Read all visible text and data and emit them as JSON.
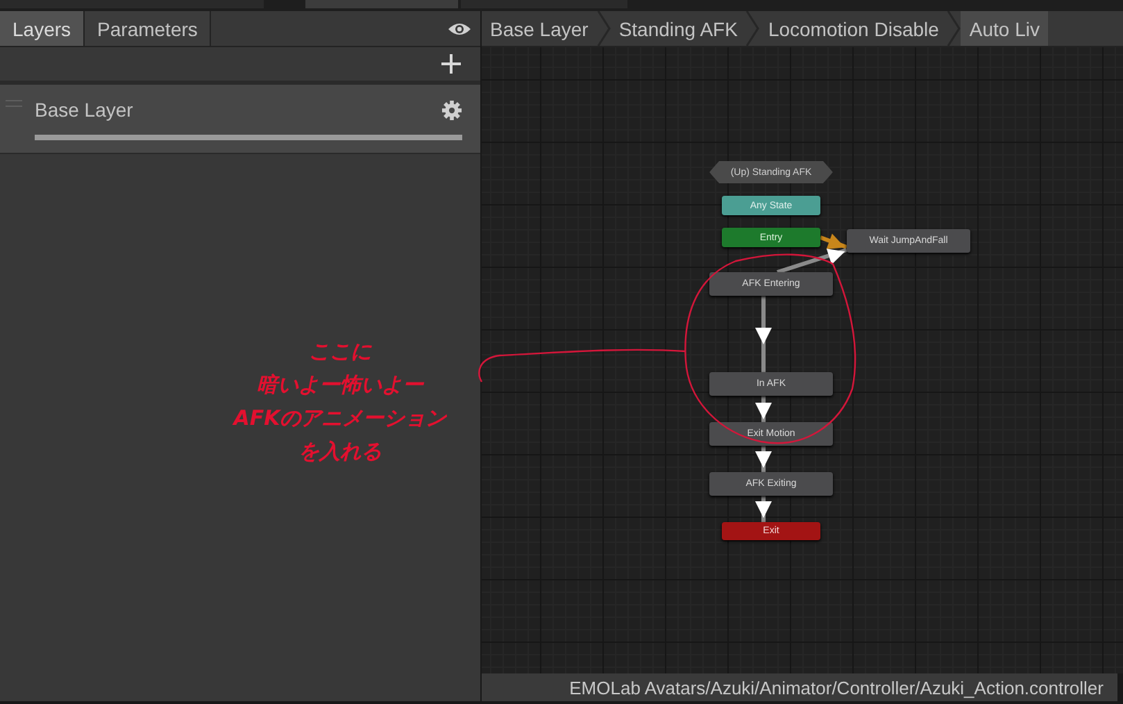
{
  "panel_tabs": [
    {
      "label": "Layers",
      "selected": true
    },
    {
      "label": "Parameters",
      "selected": false
    }
  ],
  "layers": [
    {
      "name": "Base Layer"
    }
  ],
  "annotation": {
    "lines": [
      "ここに",
      "暗いよー怖いよー",
      "AFKのアニメーション",
      "を入れる"
    ]
  },
  "breadcrumbs": [
    {
      "label": "Base Layer",
      "selected": false
    },
    {
      "label": "Standing AFK",
      "selected": false
    },
    {
      "label": "Locomotion Disable",
      "selected": false
    },
    {
      "label": "Auto Liv",
      "selected": true
    }
  ],
  "graph": {
    "nodes": [
      {
        "label": "(Up) Standing AFK",
        "kind": "parent"
      },
      {
        "label": "Any State",
        "kind": "any"
      },
      {
        "label": "Entry",
        "kind": "entry"
      },
      {
        "label": "Wait JumpAndFall",
        "kind": "state"
      },
      {
        "label": "AFK Entering",
        "kind": "state"
      },
      {
        "label": "In AFK",
        "kind": "state"
      },
      {
        "label": "Exit Motion",
        "kind": "state"
      },
      {
        "label": "AFK Exiting",
        "kind": "state"
      },
      {
        "label": "Exit",
        "kind": "exit"
      }
    ]
  },
  "status_bar": {
    "path": "EMOLab Avatars/Azuki/Animator/Controller/Azuki_Action.controller"
  }
}
